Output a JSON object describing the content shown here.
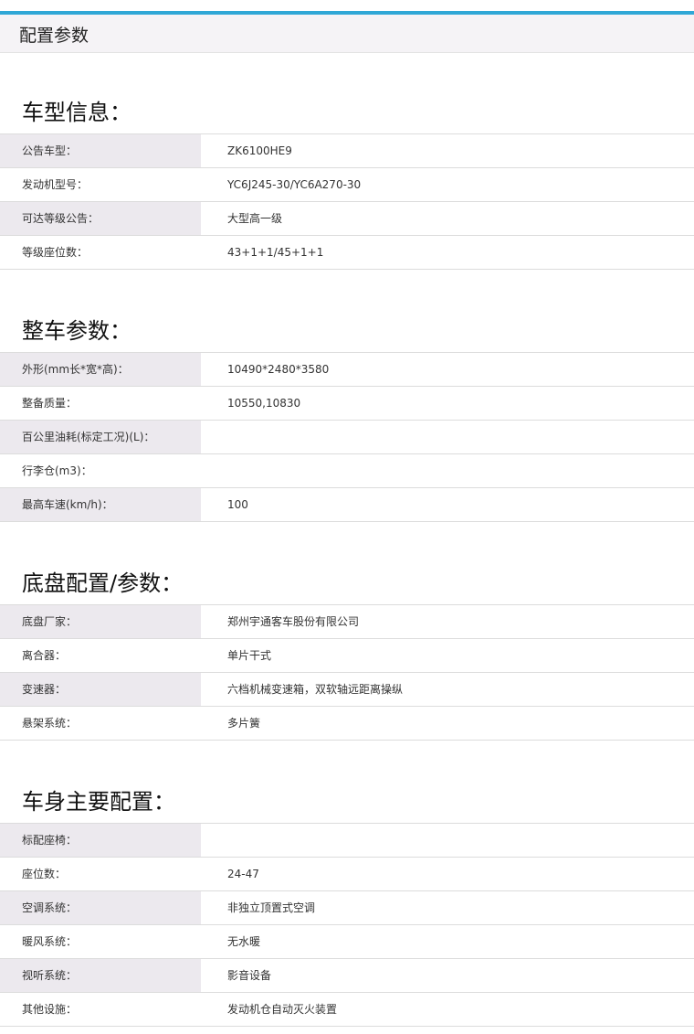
{
  "header": {
    "title": "配置参数"
  },
  "sections": [
    {
      "title": "车型信息：",
      "rows": [
        {
          "label": "公告车型：",
          "value": "ZK6100HE9"
        },
        {
          "label": "发动机型号：",
          "value": "YC6J245-30/YC6A270-30"
        },
        {
          "label": "可达等级公告：",
          "value": "大型高一级"
        },
        {
          "label": "等级座位数：",
          "value": "43+1+1/45+1+1"
        }
      ]
    },
    {
      "title": "整车参数：",
      "rows": [
        {
          "label": "外形(mm长*宽*高)：",
          "value": "10490*2480*3580"
        },
        {
          "label": "整备质量：",
          "value": "10550,10830"
        },
        {
          "label": "百公里油耗(标定工况)(L)：",
          "value": ""
        },
        {
          "label": "行李仓(m3)：",
          "value": ""
        },
        {
          "label": "最高车速(km/h)：",
          "value": "100"
        }
      ]
    },
    {
      "title": "底盘配置/参数：",
      "rows": [
        {
          "label": "底盘厂家：",
          "value": "郑州宇通客车股份有限公司"
        },
        {
          "label": "离合器：",
          "value": "单片干式"
        },
        {
          "label": "变速器：",
          "value": "六档机械变速箱，双软轴远距离操纵"
        },
        {
          "label": "悬架系统：",
          "value": "多片簧"
        }
      ]
    },
    {
      "title": "车身主要配置：",
      "rows": [
        {
          "label": "标配座椅：",
          "value": ""
        },
        {
          "label": "座位数：",
          "value": "24-47"
        },
        {
          "label": "空调系统：",
          "value": "非独立顶置式空调"
        },
        {
          "label": "暖风系统：",
          "value": "无水暖"
        },
        {
          "label": "视听系统：",
          "value": "影音设备"
        },
        {
          "label": "其他设施：",
          "value": "发动机仓自动灭火装置"
        }
      ]
    }
  ]
}
